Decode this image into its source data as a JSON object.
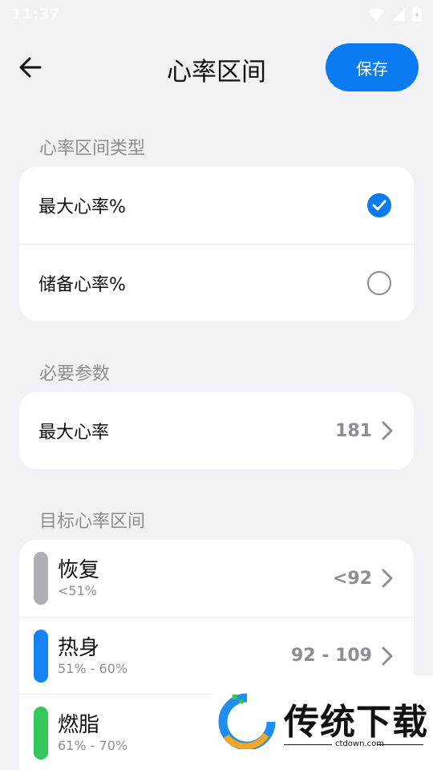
{
  "status": {
    "time": "11:37"
  },
  "header": {
    "title": "心率区间",
    "save_label": "保存"
  },
  "sections": {
    "type_label": "心率区间类型",
    "params_label": "必要参数",
    "zones_label": "目标心率区间"
  },
  "type_options": [
    {
      "label": "最大心率%",
      "selected": true
    },
    {
      "label": "储备心率%",
      "selected": false
    }
  ],
  "params": {
    "max_hr_label": "最大心率",
    "max_hr_value": "181"
  },
  "zones": [
    {
      "name": "恢复",
      "range": "<51%",
      "value": "<92",
      "color": "#b0b0b4"
    },
    {
      "name": "热身",
      "range": "51% - 60%",
      "value": "92 - 109",
      "color": "#1683f5"
    },
    {
      "name": "燃脂",
      "range": "61% - 70%",
      "value": "",
      "color": "#34c759"
    }
  ],
  "watermark": {
    "brand": "传统下载",
    "url": "ctdown.com"
  }
}
